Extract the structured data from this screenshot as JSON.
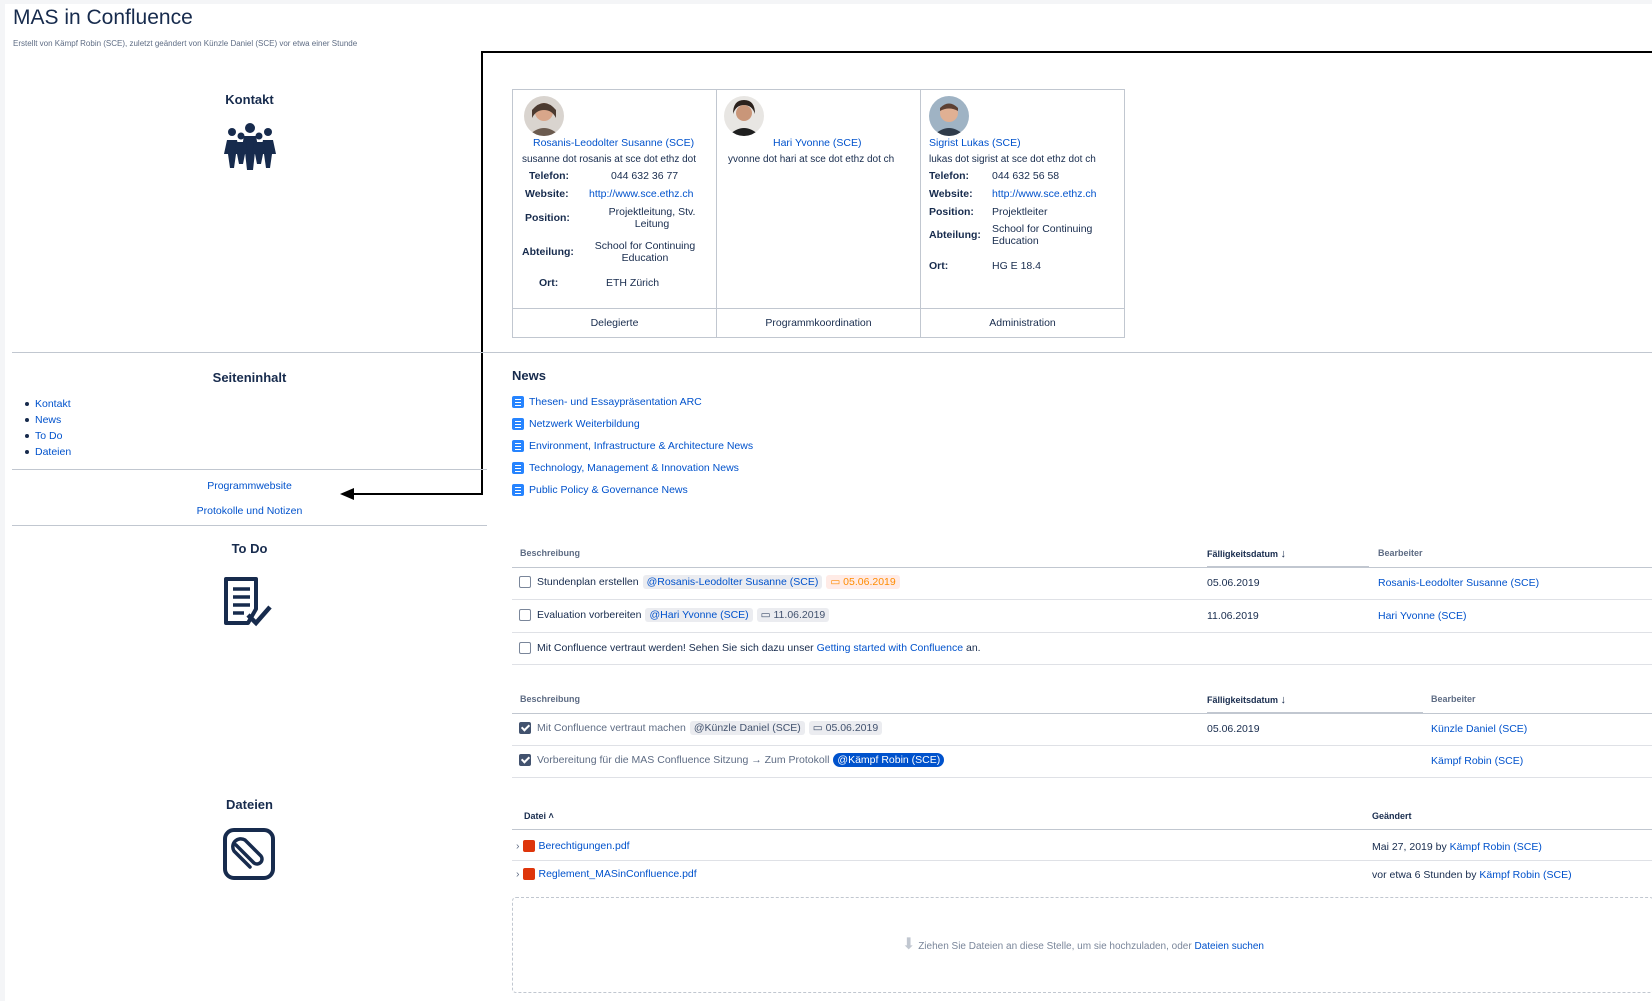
{
  "page": {
    "title": "MAS in Confluence",
    "byline": "Erstellt von Kämpf Robin (SCE), zuletzt geändert von Künzle Daniel (SCE) vor etwa einer Stunde"
  },
  "kontakt": {
    "heading": "Kontakt"
  },
  "contacts": [
    {
      "name": "Rosanis-Leodolter Susanne (SCE)",
      "email": "susanne dot rosanis at sce dot ethz dot",
      "phone_label": "Telefon:",
      "phone": "044 632 36 77",
      "website_label": "Website:",
      "website": "http://www.sce.ethz.ch",
      "position_label": "Position:",
      "position": "Projektleitung, Stv. Leitung",
      "department_label": "Abteilung:",
      "department": "School for Continuing Education",
      "location_label": "Ort:",
      "location": "ETH Zürich",
      "role": "Delegierte"
    },
    {
      "name": "Hari Yvonne (SCE)",
      "email": "yvonne dot hari at sce dot ethz dot ch",
      "role": "Programmkoordination"
    },
    {
      "name": "Sigrist Lukas (SCE)",
      "email": "lukas dot sigrist at sce dot ethz dot ch",
      "phone_label": "Telefon:",
      "phone": "044 632 56 58",
      "website_label": "Website:",
      "website": "http://www.sce.ethz.ch",
      "position_label": "Position:",
      "position": "Projektleiter",
      "department_label": "Abteilung:",
      "department": "School for Continuing Education",
      "location_label": "Ort:",
      "location": "HG E 18.4",
      "role": "Administration"
    }
  ],
  "seiteninhalt": {
    "heading": "Seiteninhalt",
    "items": [
      "Kontakt",
      "News",
      "To Do",
      "Dateien"
    ],
    "links": [
      "Programmwebsite",
      "Protokolle und Notizen"
    ]
  },
  "news": {
    "heading": "News",
    "items": [
      "Thesen- und Essaypräsentation ARC",
      "Netzwerk Weiterbildung",
      "Environment, Infrastructure & Architecture News",
      "Technology, Management & Innovation News",
      "Public Policy & Governance News"
    ]
  },
  "todo": {
    "heading": "To Do",
    "table1": {
      "col_desc": "Beschreibung",
      "col_due": "Fälligkeitsdatum",
      "col_assignee": "Bearbeiter",
      "rows": [
        {
          "text": "Stundenplan erstellen",
          "mention": "@Rosanis-Leodolter Susanne (SCE)",
          "date": "05.06.2019",
          "due": "05.06.2019",
          "assignee": "Rosanis-Leodolter Susanne (SCE)"
        },
        {
          "text": "Evaluation vorbereiten",
          "mention": "@Hari Yvonne (SCE)",
          "date": "11.06.2019",
          "due": "11.06.2019",
          "assignee": "Hari Yvonne (SCE)"
        },
        {
          "text_pre": "Mit Confluence vertraut werden! Sehen Sie sich dazu unser ",
          "link": "Getting started with Confluence",
          "text_post": " an."
        }
      ]
    },
    "table2": {
      "col_desc": "Beschreibung",
      "col_due": "Fälligkeitsdatum",
      "col_assignee": "Bearbeiter",
      "rows": [
        {
          "text": "Mit Confluence vertraut machen",
          "mention": "@Künzle Daniel (SCE)",
          "date": "05.06.2019",
          "due": "05.06.2019",
          "assignee": "Künzle Daniel (SCE)"
        },
        {
          "text": "Vorbereitung für die MAS Confluence Sitzung → Zum Protokoll",
          "mention": "@Kämpf Robin (SCE)",
          "assignee": "Kämpf Robin (SCE)"
        }
      ]
    }
  },
  "files": {
    "heading": "Dateien",
    "col_file": "Datei",
    "col_changed": "Geändert",
    "rows": [
      {
        "name": "Berechtigungen.pdf",
        "changed_pre": "Mai 27, 2019 by ",
        "changed_by": "Kämpf Robin (SCE)"
      },
      {
        "name": "Reglement_MASinConfluence.pdf",
        "changed_pre": "vor etwa 6 Stunden by ",
        "changed_by": "Kämpf Robin (SCE)"
      }
    ],
    "drop_text": "Ziehen Sie Dateien an diese Stelle, um sie hochzuladen, oder ",
    "drop_link": "Dateien suchen"
  }
}
